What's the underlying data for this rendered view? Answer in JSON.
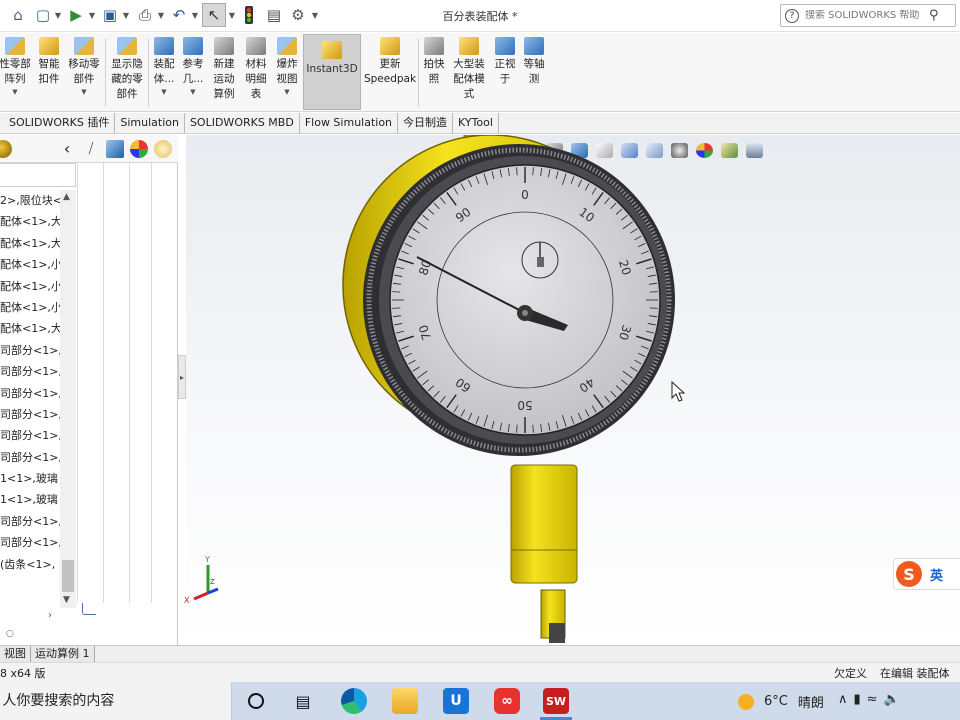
{
  "titlebar": {
    "document_title": "百分表装配体 *",
    "help_search_placeholder": "搜索 SOLIDWORKS 帮助"
  },
  "quick_access": [
    "home-icon",
    "new-document-icon",
    "open-icon",
    "save-icon",
    "print-icon",
    "undo-icon",
    "select-icon",
    "rebuild-icon",
    "file-properties-icon",
    "options-icon"
  ],
  "ribbon": {
    "buttons": [
      {
        "label": "性零部\n阵列",
        "icon": "linear-component-pattern-icon",
        "dropdown": true
      },
      {
        "label": "智能\n扣件",
        "icon": "smart-fasteners-icon",
        "dropdown": false
      },
      {
        "label": "移动零\n部件",
        "icon": "move-component-icon",
        "dropdown": true
      },
      {
        "label": "显示隐\n藏的零\n部件",
        "icon": "show-hidden-components-icon",
        "dropdown": false
      },
      {
        "label": "装配\n体...",
        "icon": "assembly-features-icon",
        "dropdown": true
      },
      {
        "label": "参考\n几...",
        "icon": "reference-geometry-icon",
        "dropdown": true
      },
      {
        "label": "新建\n运动\n算例",
        "icon": "new-motion-study-icon",
        "dropdown": false
      },
      {
        "label": "材料\n明细\n表",
        "icon": "bill-of-materials-icon",
        "dropdown": false
      },
      {
        "label": "爆炸\n视图",
        "icon": "exploded-view-icon",
        "dropdown": true
      },
      {
        "label": "Instant3D",
        "icon": "instant3d-icon",
        "dropdown": false
      },
      {
        "label": "更新\nSpeedpak",
        "icon": "update-speedpak-icon",
        "dropdown": false
      },
      {
        "label": "拍快\n照",
        "icon": "take-snapshot-icon",
        "dropdown": false
      },
      {
        "label": "大型装\n配体模\n式",
        "icon": "large-assembly-mode-icon",
        "dropdown": false
      },
      {
        "label": "正视\n于",
        "icon": "normal-to-icon",
        "dropdown": false
      },
      {
        "label": "等轴\n测",
        "icon": "isometric-icon",
        "dropdown": false
      }
    ]
  },
  "tabs": [
    "SOLIDWORKS 插件",
    "Simulation",
    "SOLIDWORKS MBD",
    "Flow Simulation",
    "今日制造",
    "KYTool"
  ],
  "feature_tree": {
    "items": [
      "2>,限位块<",
      "配体<1>,大",
      "配体<1>,大",
      "配体<1>,小",
      "配体<1>,小",
      "配体<1>,小",
      "配体<1>,大",
      "司部分<1>,",
      "司部分<1>,",
      "司部分<1>,",
      "司部分<1>,",
      "司部分<1>,",
      "司部分<1>,",
      "1<1>,玻璃",
      "1<1>,玻璃",
      "司部分<1>,",
      "司部分<1>,",
      "(齿条<1>,"
    ]
  },
  "graphics": {
    "triad": {
      "x_label": "X",
      "y_label": "Y",
      "z_label": "Z"
    },
    "dial": {
      "major_labels": [
        "0",
        "10",
        "20",
        "30",
        "40",
        "50",
        "60",
        "70",
        "80",
        "90"
      ],
      "needle_reading": 83,
      "small_dial_reading": 1.5
    },
    "colors": {
      "body": "#e8d21a",
      "dial_face": "#d9d9dc",
      "bezel": "#3b3b40",
      "needle": "#2a2a2a"
    }
  },
  "ime": {
    "mode": "英"
  },
  "bottom_tabs": [
    "视图",
    "运动算例 1"
  ],
  "status": {
    "left": "8 x64 版",
    "state": "欠定义",
    "editing": "在编辑 装配体"
  },
  "taskbar": {
    "search_text": " 人你要搜索的内容",
    "weather_temp": "6°C",
    "weather_desc": "晴朗",
    "apps": [
      "task-view-icon",
      "edge-icon",
      "file-explorer-icon",
      "app-u-icon",
      "app-infinity-icon",
      "solidworks-icon"
    ]
  }
}
